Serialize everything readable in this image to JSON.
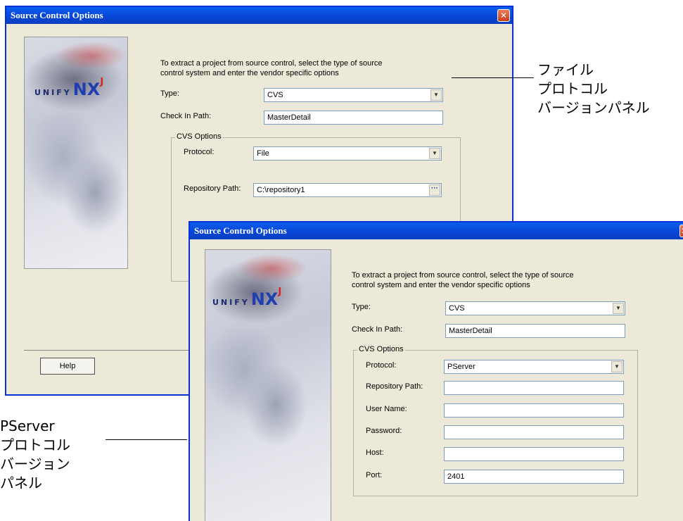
{
  "dialog_title": "Source Control Options",
  "logo": {
    "brand": "UNIFY",
    "product": "NX",
    "sup": "J"
  },
  "intro_line1": "To extract a project from source control, select the type of source",
  "intro_line2": "control system and enter the vendor specific options",
  "labels": {
    "type": "Type:",
    "check_in_path": "Check In Path:",
    "cvs_options": "CVS Options",
    "protocol": "Protocol:",
    "repository_path": "Repository Path:",
    "user_name": "User Name:",
    "password": "Password:",
    "host": "Host:",
    "port": "Port:",
    "help": "Help"
  },
  "back_dialog": {
    "type_value": "CVS",
    "check_in_path_value": "MasterDetail",
    "protocol_value": "File",
    "repository_path_value": "C:\\repository1"
  },
  "front_dialog": {
    "type_value": "CVS",
    "check_in_path_value": "MasterDetail",
    "protocol_value": "PServer",
    "repository_path_value": "",
    "user_name_value": "",
    "password_value": "",
    "host_value": "",
    "port_value": "2401"
  },
  "callouts": {
    "file_protocol": [
      "ファイル",
      "プロトコル",
      "バージョンパネル"
    ],
    "pserver_protocol": [
      "PServer",
      "プロトコル",
      "バージョン",
      "パネル"
    ]
  },
  "colors": {
    "titlebar": "#0846d6",
    "dialog_bg": "#ece9d8",
    "close_button": "#c8401e"
  }
}
